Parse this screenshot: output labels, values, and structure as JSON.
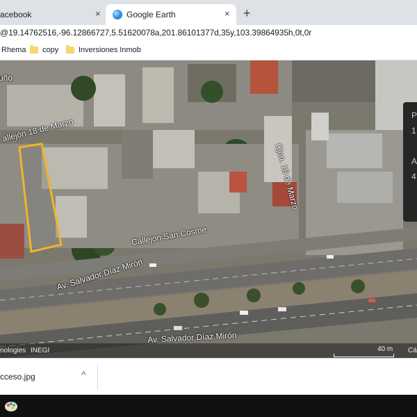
{
  "tabs": [
    {
      "title": "acebook",
      "close": "×"
    },
    {
      "title": "Google Earth",
      "close": "×"
    }
  ],
  "new_tab": "+",
  "address": {
    "url": "@19.14762516,-96.12866727,5.51620078a,201.86101377d,35y,103.39864935h,0t,0r"
  },
  "bookmarks": [
    {
      "label": "Rhema",
      "icon": "folder-icon"
    },
    {
      "label": "copy",
      "icon": "folder-icon"
    },
    {
      "label": "Inversiones Inmob",
      "icon": "folder-icon"
    }
  ],
  "map": {
    "labels": {
      "uno": "uño",
      "street_18_marzo": "allejón 18 de Marzo",
      "cjon_18_marzo": "Cjon. 18 de Marzo",
      "san_cosme": "Callejon San Cosme",
      "diaz_miron_1": "Av. Salvador Díaz Mirón",
      "diaz_miron_2": "Av. Salvador Díaz Mirón"
    },
    "info_panel": {
      "row1_label": "P",
      "row1_value": "1",
      "row2_label": "A",
      "row2_value": "4"
    },
    "attribution": {
      "tech": "nologies",
      "inegi": "INEGI",
      "scale": "40 m",
      "camera": "Cá"
    },
    "highlight_color": "#f0b429"
  },
  "downloads": {
    "file_name": "cceso.jpg",
    "chevron": "^"
  },
  "taskbar": {
    "app_icon": "paint-icon"
  }
}
